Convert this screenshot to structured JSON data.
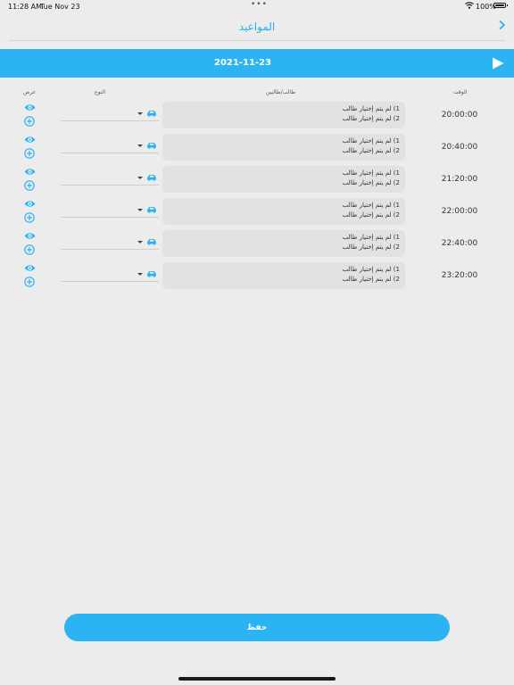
{
  "status_bar": {
    "time": "11:28 AM",
    "date": "Tue Nov 23",
    "battery": "100%"
  },
  "header": {
    "title": "المواعيد"
  },
  "date_bar": {
    "date": "2021-11-23"
  },
  "columns": {
    "view": "عرض",
    "type": "النوع",
    "students": "طالب/طالبين",
    "time": "الوقت"
  },
  "rows": [
    {
      "time": "20:00:00",
      "line1": "1) لم يتم إختيار طالب",
      "line2": "2) لم يتم إختيار طالب"
    },
    {
      "time": "20:40:00",
      "line1": "1) لم يتم إختيار طالب",
      "line2": "2) لم يتم إختيار طالب"
    },
    {
      "time": "21:20:00",
      "line1": "1) لم يتم إختيار طالب",
      "line2": "2) لم يتم إختيار طالب"
    },
    {
      "time": "22:00:00",
      "line1": "1) لم يتم إختيار طالب",
      "line2": "2) لم يتم إختيار طالب"
    },
    {
      "time": "22:40:00",
      "line1": "1) لم يتم إختيار طالب",
      "line2": "2) لم يتم إختيار طالب"
    },
    {
      "time": "23:20:00",
      "line1": "1) لم يتم إختيار طالب",
      "line2": "2) لم يتم إختيار طالب"
    }
  ],
  "save_label": "حفظ",
  "icons": {
    "view": "eye-icon",
    "add": "plus-circle-icon",
    "type": "car-icon",
    "back": "chevron-right-icon",
    "next": "play-icon"
  },
  "colors": {
    "accent": "#2bb4f1",
    "background": "#ececec",
    "cell": "#e2e2e2"
  }
}
